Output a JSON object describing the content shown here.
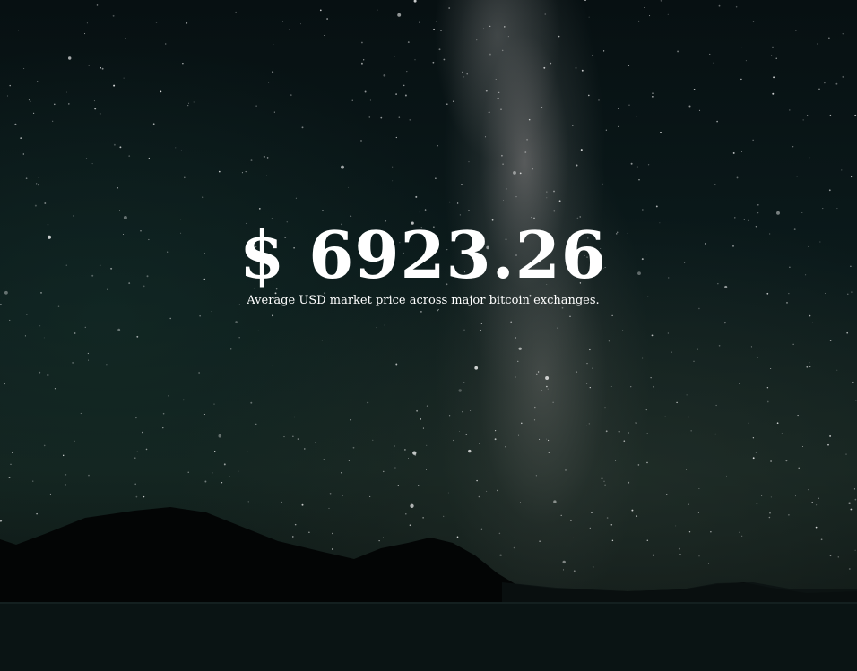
{
  "price": {
    "currency_symbol": "$",
    "value": "6923.26",
    "display": "$ 6923.26"
  },
  "subtitle": "Average USD market price across major bitcoin exchanges."
}
